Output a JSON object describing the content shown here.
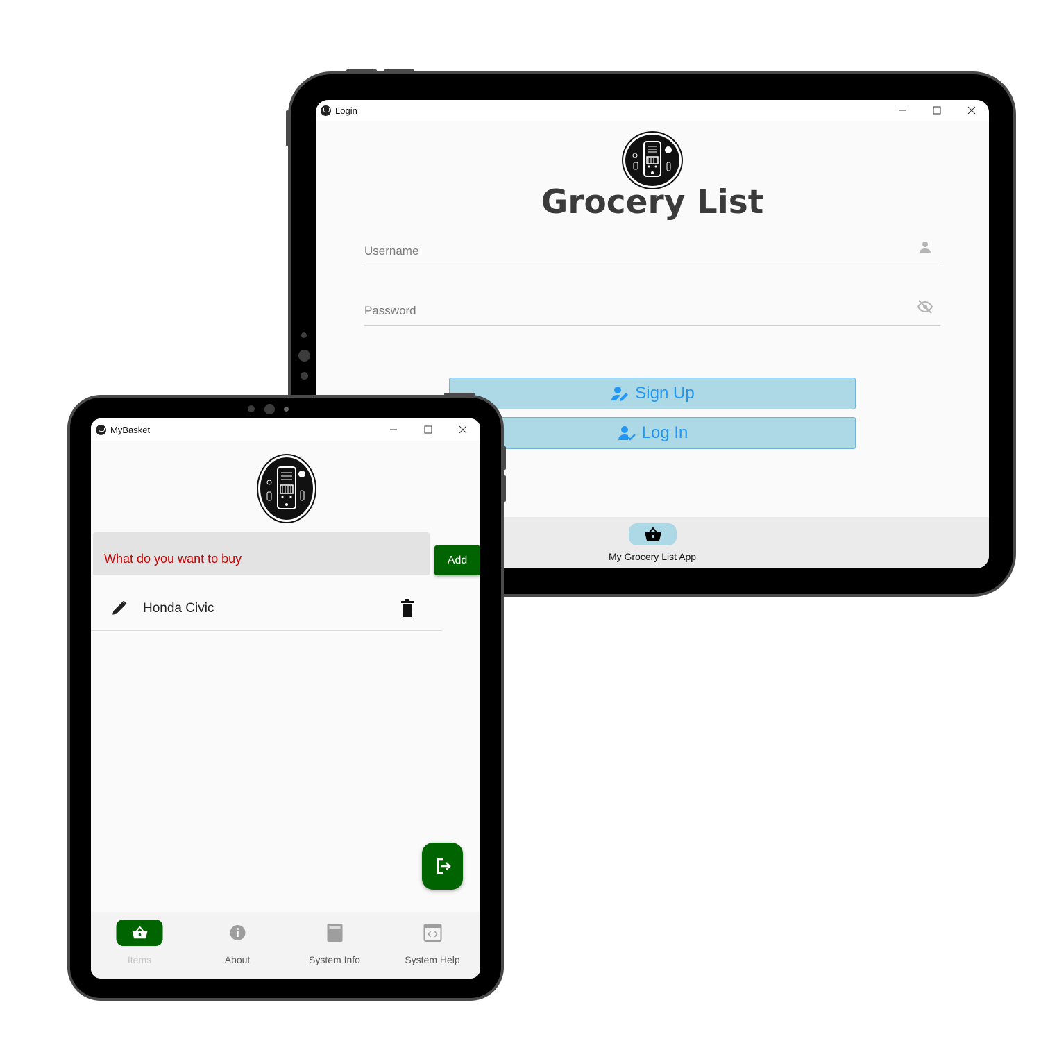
{
  "login_window": {
    "title": "Login",
    "app_title": "Grocery List",
    "username_label": "Username",
    "password_label": "Password",
    "signup_label": "Sign Up",
    "login_label": "Log In",
    "bottom_nav_label": "My Grocery List App",
    "colors": {
      "button_bg": "#add8e6",
      "button_text": "#2196f3",
      "title": "#3b3b3b"
    }
  },
  "basket_window": {
    "title": "MyBasket",
    "input_label": "What do you want to buy",
    "add_label": "Add",
    "items": [
      {
        "name": "Honda Civic"
      }
    ],
    "tabs": [
      {
        "label": "Items",
        "icon": "basket-icon",
        "active": true
      },
      {
        "label": "About",
        "icon": "info-icon",
        "active": false
      },
      {
        "label": "System Info",
        "icon": "system-info-icon",
        "active": false
      },
      {
        "label": "System Help",
        "icon": "system-help-icon",
        "active": false
      }
    ],
    "colors": {
      "accent": "#006400",
      "input_label": "#c80000"
    }
  }
}
